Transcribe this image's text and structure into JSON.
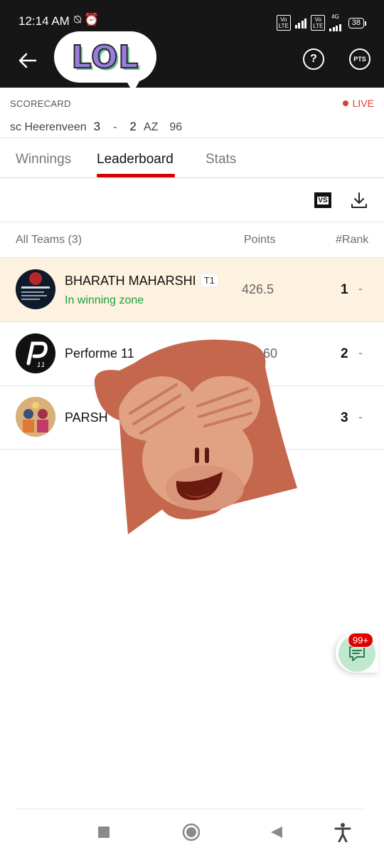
{
  "status_bar": {
    "time": "12:14 AM",
    "network_label_1": "Vo LTE",
    "network_label_2": "Vo LTE",
    "network_type": "4G",
    "battery": "38"
  },
  "header": {
    "sticker_text": "LOL",
    "help_icon": "help-chat-icon",
    "pts_label": "PTS"
  },
  "scorecard": {
    "label": "SCORECARD",
    "live_label": "LIVE",
    "team_a": "sc Heerenveen",
    "score_a": "3",
    "separator": "-",
    "score_b": "2",
    "team_b": "AZ",
    "minute": "96"
  },
  "tabs": [
    {
      "label": "Winnings",
      "active": false
    },
    {
      "label": "Leaderboard",
      "active": true
    },
    {
      "label": "Stats",
      "active": false
    }
  ],
  "toolbar": {
    "compare_icon_label": "VS",
    "download_icon": "download-icon"
  },
  "table": {
    "header_teams": "All Teams (3)",
    "header_points": "Points",
    "header_rank": "#Rank",
    "rows": [
      {
        "name": "BHARATH MAHARSHI",
        "tag": "T1",
        "status": "In winning zone",
        "points": "426.5",
        "rank": "1",
        "change": "-"
      },
      {
        "name": "Performe 11",
        "tag": "",
        "status": "",
        "points": "60",
        "rank": "2",
        "change": "-"
      },
      {
        "name": "PARSH",
        "tag": "",
        "status": "",
        "points": "",
        "rank": "3",
        "change": "-"
      }
    ]
  },
  "chat": {
    "badge": "99+"
  },
  "colors": {
    "accent_red": "#d50000",
    "live_red": "#e53935",
    "winning_green": "#1e9e3a",
    "highlight_row": "#fdf2df",
    "header_bg": "#161616"
  }
}
